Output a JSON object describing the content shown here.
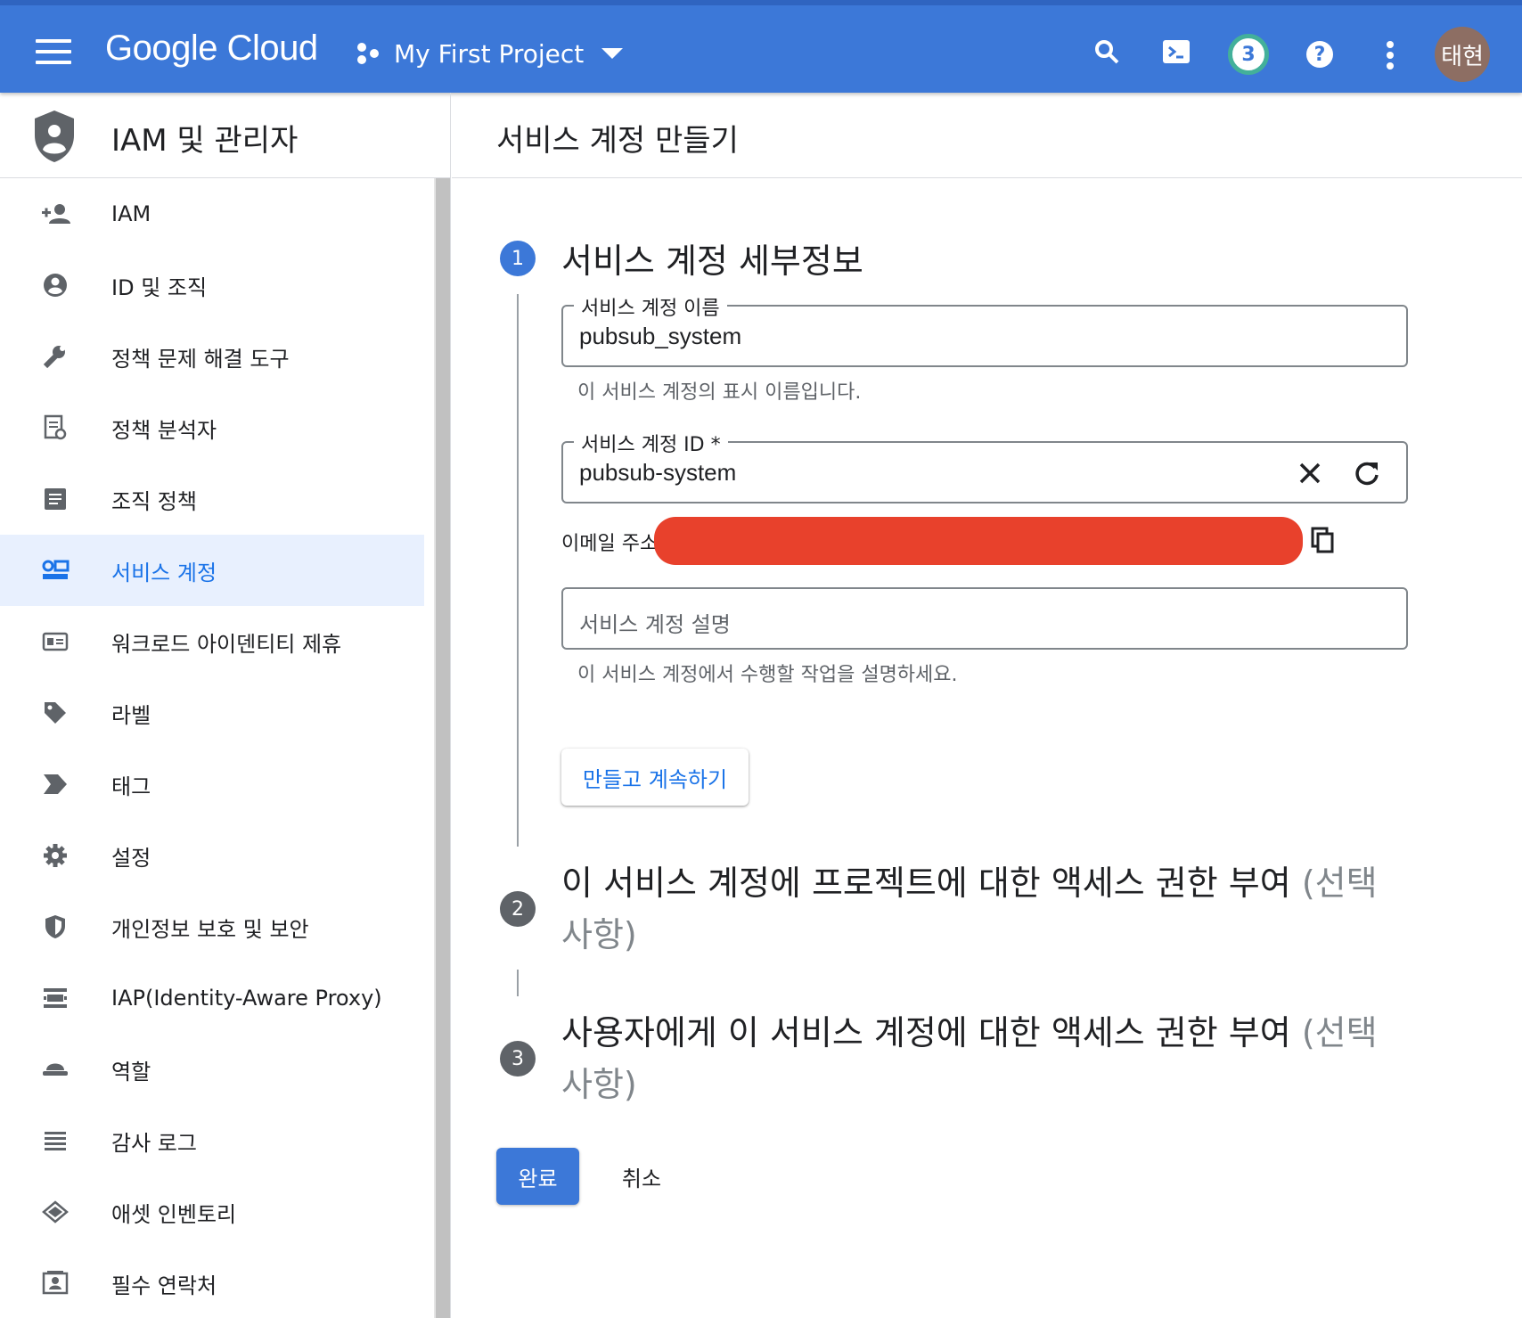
{
  "topbar": {
    "logo": "Google Cloud",
    "project": "My First Project",
    "notifications_count": "3",
    "avatar_text": "태현",
    "brand_color": "#3c78d8"
  },
  "sidebar": {
    "title": "IAM 및 관리자",
    "items": [
      {
        "label": "IAM",
        "icon": "person-add-icon"
      },
      {
        "label": "ID 및 조직",
        "icon": "account-circle-icon"
      },
      {
        "label": "정책 문제 해결 도구",
        "icon": "wrench-icon"
      },
      {
        "label": "정책 분석자",
        "icon": "policy-analyzer-icon"
      },
      {
        "label": "조직 정책",
        "icon": "document-icon"
      },
      {
        "label": "서비스 계정",
        "icon": "service-account-icon",
        "active": true
      },
      {
        "label": "워크로드 아이덴티티 제휴",
        "icon": "id-card-icon"
      },
      {
        "label": "라벨",
        "icon": "label-icon"
      },
      {
        "label": "태그",
        "icon": "tag-icon"
      },
      {
        "label": "설정",
        "icon": "gear-icon"
      },
      {
        "label": "개인정보 보호 및 보안",
        "icon": "shield-icon"
      },
      {
        "label": "IAP(Identity-Aware Proxy)",
        "icon": "iap-icon"
      },
      {
        "label": "역할",
        "icon": "role-hat-icon"
      },
      {
        "label": "감사 로그",
        "icon": "list-icon"
      },
      {
        "label": "애셋 인벤토리",
        "icon": "layers-icon"
      },
      {
        "label": "필수 연락처",
        "icon": "contact-card-icon"
      }
    ]
  },
  "main": {
    "title": "서비스 계정 만들기",
    "step1": {
      "number": "1",
      "title": "서비스 계정 세부정보",
      "name_field": {
        "label": "서비스 계정 이름",
        "value": "pubsub_system",
        "hint": "이 서비스 계정의 표시 이름입니다."
      },
      "id_field": {
        "label": "서비스 계정 ID *",
        "value": "pubsub-system"
      },
      "email_label": "이메일 주소",
      "desc_field": {
        "placeholder": "서비스 계정 설명",
        "hint": "이 서비스 계정에서 수행할 작업을 설명하세요."
      },
      "create_button": "만들고 계속하기"
    },
    "step2": {
      "number": "2",
      "title": "이 서비스 계정에 프로젝트에 대한 액세스 권한 부여",
      "optional": "(선택사항)"
    },
    "step3": {
      "number": "3",
      "title": "사용자에게 이 서비스 계정에 대한 액세스 권한 부여",
      "optional": "(선택사항)"
    },
    "done_button": "완료",
    "cancel_button": "취소"
  }
}
